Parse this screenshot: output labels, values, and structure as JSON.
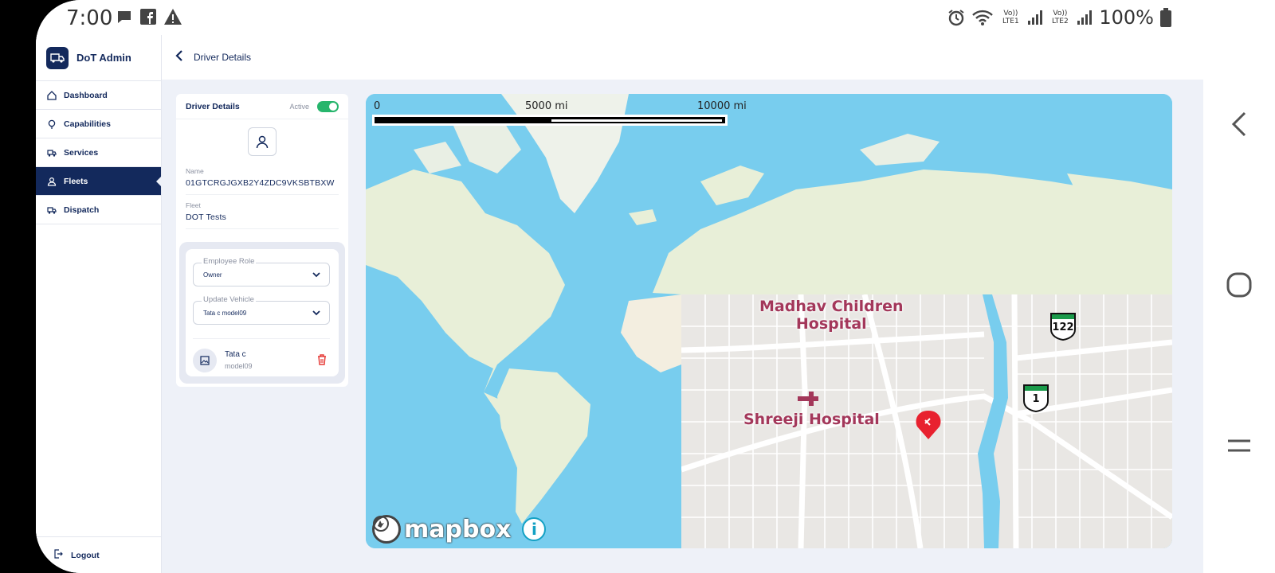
{
  "status_bar": {
    "time": "7:00",
    "battery": "100%",
    "sim1": "Vo)) LTE1",
    "sim2": "Vo)) LTE2",
    "icons": [
      "chat-icon",
      "facebook-icon",
      "warning-icon",
      "alarm-icon",
      "wifi-icon",
      "signal-icon",
      "battery-icon"
    ]
  },
  "brand": {
    "name": "DoT Admin"
  },
  "sidebar": {
    "items": [
      {
        "label": "Dashboard",
        "icon": "home-icon"
      },
      {
        "label": "Capabilities",
        "icon": "bulb-icon"
      },
      {
        "label": "Services",
        "icon": "truck-icon"
      },
      {
        "label": "Fleets",
        "icon": "user-icon",
        "active": true
      },
      {
        "label": "Dispatch",
        "icon": "dispatch-icon"
      }
    ],
    "logout": "Logout"
  },
  "header": {
    "title": "Driver Details"
  },
  "driver_card": {
    "title": "Driver Details",
    "status": "Active",
    "name_label": "Name",
    "name_value": "01GTCRGJGXB2Y4ZDC9VKSBTBXW",
    "fleet_label": "Fleet",
    "fleet_value": "DOT Tests",
    "employee_role": {
      "label": "Employee Role",
      "value": "Owner"
    },
    "update_vehicle": {
      "label": "Update Vehicle",
      "value": "Tata c model09"
    },
    "vehicle": {
      "name": "Tata c",
      "model": "model09"
    }
  },
  "map": {
    "scale": {
      "zero": "0",
      "mid": "5000 mi",
      "end": "10000 mi"
    },
    "attribution": "mapbox",
    "inset_labels": {
      "hospital1": "Madhav Children\nHospital",
      "hospital2": "Shreeji Hospital"
    },
    "shields": [
      "122",
      "1"
    ]
  },
  "colors": {
    "primary": "#13295c",
    "active_toggle": "#26b56c",
    "water": "#78cdee",
    "land": "#e8efd8",
    "delete": "#e53935",
    "marker": "#e8212f"
  }
}
